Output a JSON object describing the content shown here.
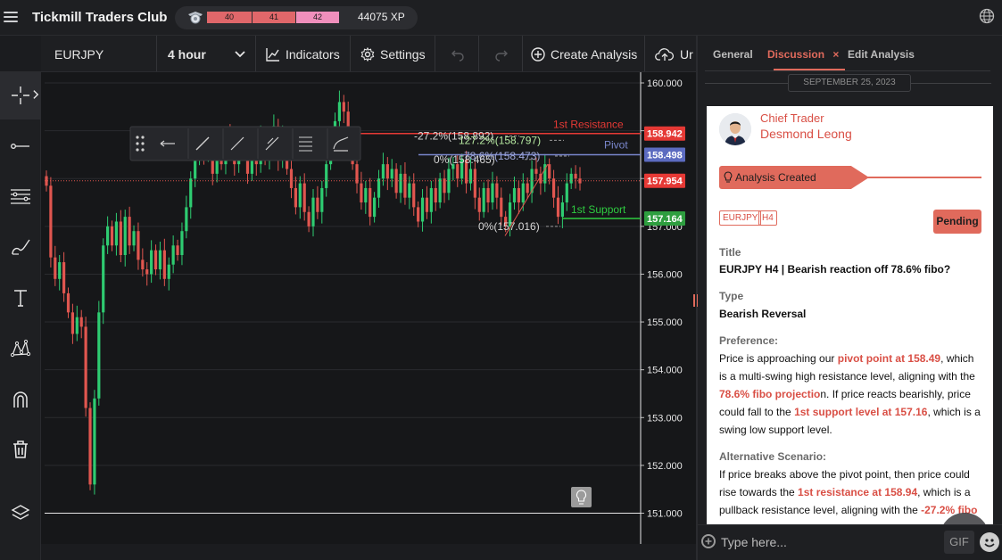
{
  "app": {
    "brand": "Tickmill Traders Club",
    "levels": [
      "40",
      "41",
      "42"
    ],
    "xp": "44075 XP"
  },
  "toolbar": {
    "symbol": "EURJPY",
    "timeframe": "4 hour",
    "indicators_label": "Indicators",
    "settings_label": "Settings",
    "create_analysis_label": "Create Analysis",
    "upload_label": "Ur"
  },
  "chart_data": {
    "type": "candlestick",
    "symbol": "EURJPY",
    "timeframe": "4 hour",
    "ylim": [
      151.0,
      160.2
    ],
    "y_ticks": [
      "160.000",
      "159.000",
      "158.000",
      "157.000",
      "156.000",
      "155.000",
      "154.000",
      "153.000",
      "152.000",
      "151.000"
    ],
    "price_tags": [
      {
        "label": "158.942",
        "value": 158.942,
        "color": "#e53935"
      },
      {
        "label": "158.498",
        "value": 158.498,
        "color": "#5c6bc0"
      },
      {
        "label": "157.954",
        "value": 157.954,
        "color": "#e53935"
      },
      {
        "label": "157.164",
        "value": 157.164,
        "color": "#2e9e3f"
      }
    ],
    "levels": [
      {
        "name": "1st Resistance",
        "value": 158.942,
        "color": "#e53935"
      },
      {
        "name": "Pivot",
        "value": 158.498,
        "color": "#7986cb"
      },
      {
        "name": "1st Support",
        "value": 157.164,
        "color": "#2ecc40"
      }
    ],
    "fib_labels": [
      {
        "text": "-27.2%(158.892)",
        "value": 158.89
      },
      {
        "text": "127.2%(158.797)",
        "value": 158.8
      },
      {
        "text": "78.6%(158.473)",
        "value": 158.47
      },
      {
        "text": "0%(158.465)",
        "value": 158.4
      },
      {
        "text": "0%(157.016)",
        "value": 157.0
      }
    ],
    "candles": [
      157.85,
      156.35,
      155.9,
      156.25,
      155.6,
      155.2,
      154.75,
      155.1,
      154.9,
      153.2,
      151.6,
      153.4,
      155.2,
      156.6,
      157.0,
      156.6,
      157.1,
      156.4,
      157.2,
      156.6,
      156.9,
      156.3,
      156.1,
      156.0,
      156.5,
      156.1,
      156.5,
      155.9,
      156.2,
      156.6,
      156.4,
      156.9,
      157.4,
      158.0,
      158.4,
      158.9,
      158.5,
      158.6,
      158.1,
      158.7,
      158.3,
      158.9,
      158.6,
      158.3,
      158.8,
      158.5,
      158.1,
      158.6,
      158.3,
      158.9,
      158.4,
      158.7,
      159.1,
      158.4,
      158.9,
      158.2,
      157.8,
      157.4,
      157.9,
      157.3,
      157.0,
      157.6,
      157.3,
      157.8,
      158.3,
      158.7,
      159.2,
      159.6,
      159.4,
      158.8,
      158.3,
      157.9,
      157.5,
      157.8,
      157.2,
      157.6,
      158.0,
      158.3,
      158.0,
      158.2,
      157.7,
      158.1,
      157.6,
      157.9,
      157.4,
      157.1,
      157.6,
      157.3,
      157.8,
      157.5,
      158.0,
      157.7,
      158.2,
      158.3,
      158.0,
      158.4,
      157.9,
      158.2,
      157.6,
      157.3,
      157.8,
      157.5,
      157.9,
      157.6,
      157.2,
      157.0,
      157.5,
      157.8,
      157.5,
      157.9,
      157.7,
      158.2,
      158.1,
      157.9,
      158.3,
      158.0,
      157.6,
      157.2,
      157.5,
      157.9,
      158.1,
      158.0,
      157.9
    ]
  },
  "panel": {
    "tabs": [
      "General",
      "Discussion",
      "Edit Analysis"
    ],
    "close_symbol": "×",
    "date": "SEPTEMBER 25, 2023",
    "author_role": "Chief Trader",
    "author_name": "Desmond Leong",
    "created_label": "Analysis Created",
    "tags": [
      "EURJPY",
      "H4"
    ],
    "status": "Pending",
    "title_label": "Title",
    "title_value": "EURJPY H4 | Bearish reaction off 78.6% fibo?",
    "type_label": "Type",
    "type_value": "Bearish Reversal",
    "preference_label": "Preference:",
    "pref": {
      "t1": "Price is approaching our ",
      "h1": "pivot point at 158.49",
      "t2": ", which is a multi-swing high resistance level, aligning with the ",
      "h2": "78.6% fibo projectio",
      "t3": "n. If price reacts bearishly, price could fall to the ",
      "h3": "1st support level at 157.16",
      "t4": ", which is a swing low support level."
    },
    "alt_label": "Alternative Scenario:",
    "alt": {
      "t1": "If price breaks above the pivot point, then price could rise towards the ",
      "h1": "1st resistance at 158.94",
      "t2": ", which is a pullback resistance level, aligning with the ",
      "h2": "-27.2% fibo"
    },
    "composer_placeholder": "Type here...",
    "gif_label": "GIF"
  }
}
